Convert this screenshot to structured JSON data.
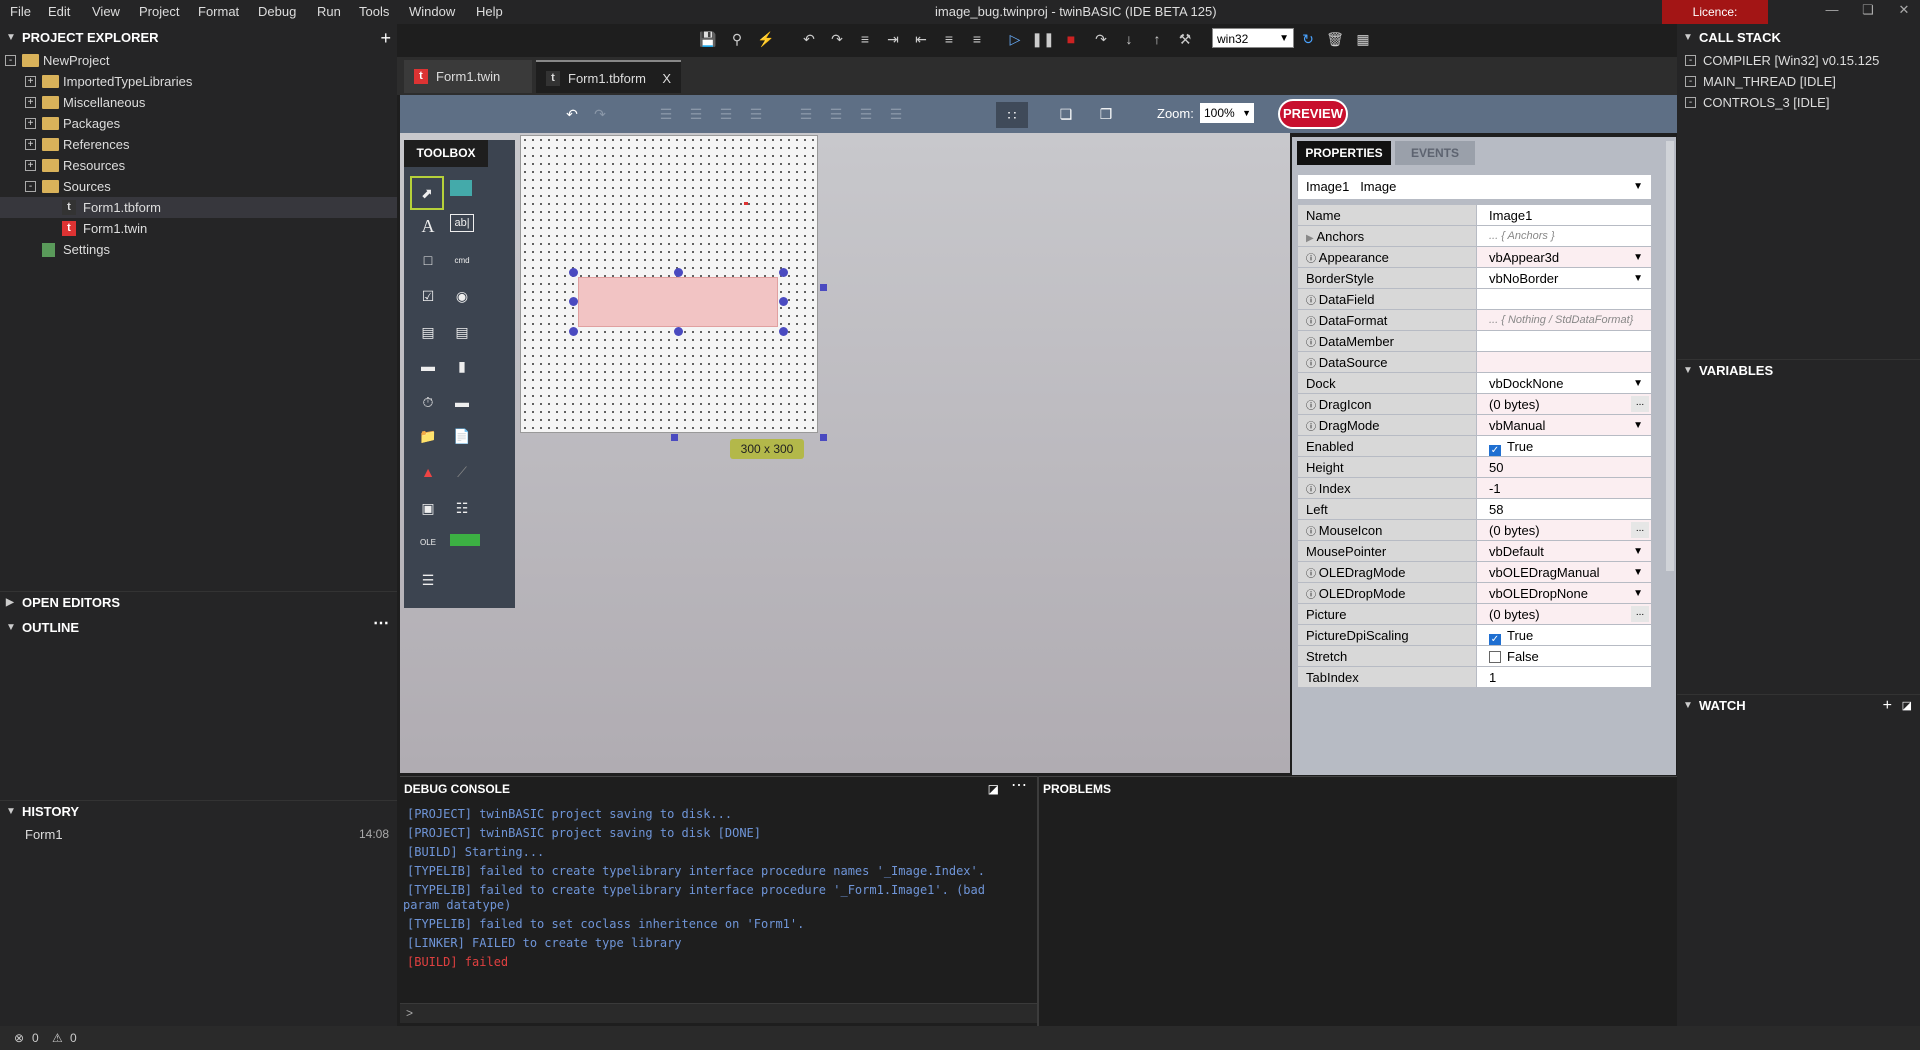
{
  "menu": [
    "File",
    "Edit",
    "View",
    "Project",
    "Format",
    "Debug",
    "Run",
    "Tools",
    "Window",
    "Help"
  ],
  "window_title": "image_bug.twinproj - twinBASIC (IDE BETA 125)",
  "licence": "Licence: COMMUNITY",
  "target": "win32",
  "project_explorer": {
    "title": "PROJECT EXPLORER",
    "root": "NewProject",
    "folders": [
      "ImportedTypeLibraries",
      "Miscellaneous",
      "Packages",
      "References",
      "Resources",
      "Sources"
    ],
    "sources": [
      "Form1.tbform",
      "Form1.twin"
    ],
    "settings": "Settings"
  },
  "open_editors": "OPEN EDITORS",
  "outline": "OUTLINE",
  "history": {
    "title": "HISTORY",
    "item": "Form1",
    "time": "14:08"
  },
  "tabs": [
    {
      "label": "Form1.twin"
    },
    {
      "label": "Form1.tbform"
    }
  ],
  "designer": {
    "zoom_label": "Zoom:",
    "zoom": "100%",
    "preview": "PREVIEW",
    "toolbox": "TOOLBOX",
    "size": "300 x 300"
  },
  "properties": {
    "tab_props": "PROPERTIES",
    "tab_events": "EVENTS",
    "object": "Image1   Image",
    "rows": [
      {
        "name": "Name",
        "value": "Image1"
      },
      {
        "name": "Anchors",
        "value": "... { Anchors }"
      },
      {
        "name": "Appearance",
        "value": "vbAppear3d"
      },
      {
        "name": "BorderStyle",
        "value": "vbNoBorder"
      },
      {
        "name": "DataField",
        "value": ""
      },
      {
        "name": "DataFormat",
        "value": "... { Nothing / StdDataFormat}"
      },
      {
        "name": "DataMember",
        "value": ""
      },
      {
        "name": "DataSource",
        "value": ""
      },
      {
        "name": "Dock",
        "value": "vbDockNone"
      },
      {
        "name": "DragIcon",
        "value": "(0 bytes)"
      },
      {
        "name": "DragMode",
        "value": "vbManual"
      },
      {
        "name": "Enabled",
        "value": "True"
      },
      {
        "name": "Height",
        "value": "50"
      },
      {
        "name": "Index",
        "value": "-1"
      },
      {
        "name": "Left",
        "value": "58"
      },
      {
        "name": "MouseIcon",
        "value": "(0 bytes)"
      },
      {
        "name": "MousePointer",
        "value": "vbDefault"
      },
      {
        "name": "OLEDragMode",
        "value": "vbOLEDragManual"
      },
      {
        "name": "OLEDropMode",
        "value": "vbOLEDropNone"
      },
      {
        "name": "Picture",
        "value": "(0 bytes)"
      },
      {
        "name": "PictureDpiScaling",
        "value": "True"
      },
      {
        "name": "Stretch",
        "value": "False"
      },
      {
        "name": "TabIndex",
        "value": "1"
      }
    ]
  },
  "call_stack": {
    "title": "CALL STACK",
    "items": [
      "COMPILER [Win32] v0.15.125",
      "MAIN_THREAD [IDLE]",
      "CONTROLS_3 [IDLE]"
    ]
  },
  "variables": "VARIABLES",
  "watch": "WATCH",
  "debug_console": {
    "title": "DEBUG CONSOLE",
    "lines": [
      "[PROJECT] twinBASIC project saving to disk...",
      "[PROJECT] twinBASIC project saving to disk [DONE]",
      "[BUILD] Starting...",
      "[TYPELIB] failed to create typelibrary interface procedure names '_Image.Index'.",
      "[TYPELIB] failed to create typelibrary interface procedure '_Form1.Image1'.  (bad",
      "param datatype)",
      "[TYPELIB] failed to set coclass inheritence on 'Form1'.",
      "[LINKER] FAILED to create type library"
    ],
    "error_line": "[BUILD] failed",
    "prompt": ">"
  },
  "problems": "PROBLEMS",
  "status": {
    "errors": "0",
    "warnings": "0"
  },
  "colors": {
    "accent_red": "#a31515",
    "preview_red": "#c8102e",
    "log_blue": "#6f95d8",
    "error_red": "#e04040"
  }
}
